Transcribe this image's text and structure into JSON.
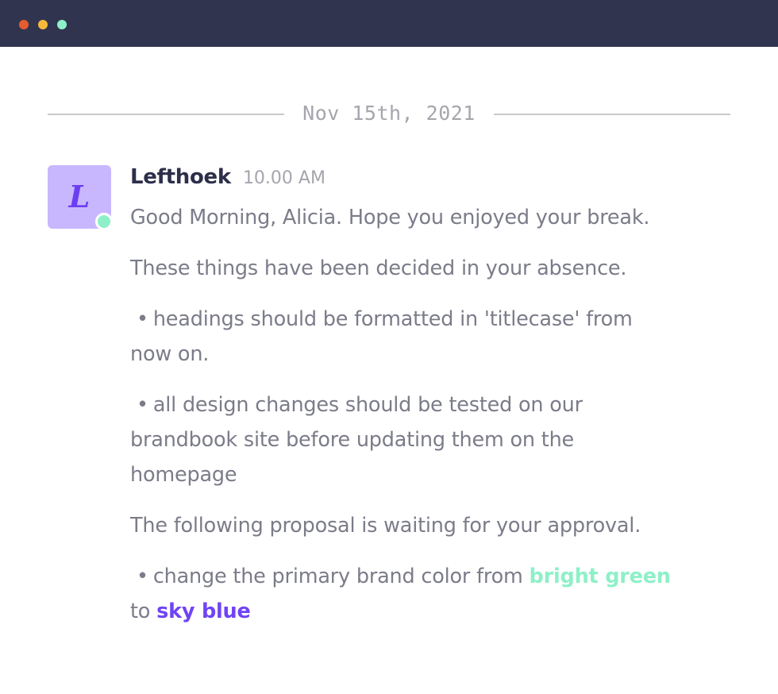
{
  "window": {
    "controls": [
      {
        "name": "close",
        "color": "#e35d2f"
      },
      {
        "name": "minimize",
        "color": "#f6b93b"
      },
      {
        "name": "maximize",
        "color": "#8ef0c8"
      }
    ]
  },
  "divider": {
    "date": "Nov 15th, 2021"
  },
  "avatar": {
    "initial": "L",
    "status": "online",
    "color": "#c8b7ff",
    "status_color": "#8ef0c8"
  },
  "message": {
    "author": "Lefthoek",
    "time": "10.00 AM",
    "greeting": "Good Morning, Alicia. Hope you enjoyed your break.",
    "intro": "These things have been decided in your absence.",
    "bullet_symbol": "•",
    "decisions": [
      {
        "line1": "headings should be formatted in 'titlecase' from",
        "line2": "now on."
      },
      {
        "line1": "all design changes should be tested on our",
        "line2": "brandbook site before updating them on the",
        "line3": "homepage"
      }
    ],
    "proposal_intro": "The following proposal is waiting for your approval.",
    "proposal": {
      "prefix": "change the primary brand color from ",
      "from_color": "bright green",
      "middle": "to ",
      "to_color": "sky blue"
    }
  }
}
